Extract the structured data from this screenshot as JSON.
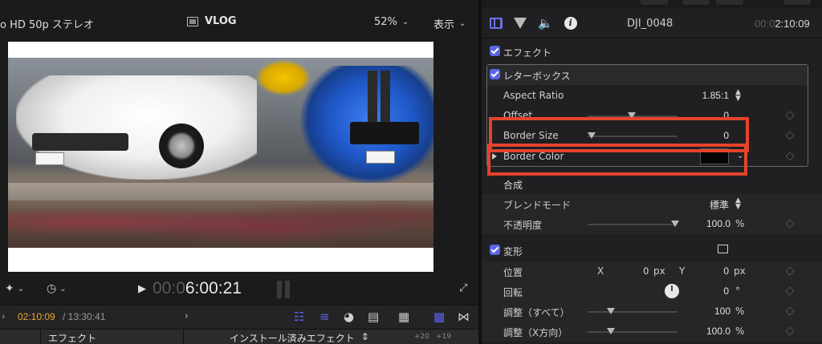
{
  "viewer": {
    "format_label": "o HD 50p ステレオ",
    "library_name": "VLOG",
    "zoom": "52%",
    "view_menu": "表示",
    "timecode_dim": "00:0",
    "timecode_bright": "6:00:21"
  },
  "timeline_bar": {
    "current_time": "02:10:09",
    "total_time": "/ 13:30:41"
  },
  "effects_browser": {
    "label": "エフェクト",
    "selector": "インストール済みエフェクト",
    "thumb_labels": [
      "+20",
      "+19"
    ]
  },
  "inspector": {
    "clip_name": "DJI_0048",
    "duration_dim": "00:0",
    "duration_bright": "2:10:09",
    "effects_header": "エフェクト",
    "letterbox": {
      "title": "レターボックス",
      "aspect_ratio_label": "Aspect Ratio",
      "aspect_ratio_value": "1.85:1",
      "offset_label": "Offset",
      "offset_value": "0",
      "border_size_label": "Border Size",
      "border_size_value": "0",
      "border_color_label": "Border Color",
      "border_color": "#050505"
    },
    "composite": {
      "title": "合成",
      "blend_mode_label": "ブレンドモード",
      "blend_mode_value": "標準",
      "opacity_label": "不透明度",
      "opacity_value": "100.0",
      "opacity_unit": "%"
    },
    "transform": {
      "title": "変形",
      "position_label": "位置",
      "x_label": "X",
      "x_value": "0",
      "y_label": "Y",
      "y_value": "0",
      "px_unit": "px",
      "rotation_label": "回転",
      "rotation_value": "0",
      "rotation_unit": "°",
      "scale_all_label": "調整（すべて）",
      "scale_all_value": "100",
      "scale_x_label": "調整（X方向）",
      "scale_x_value": "100.0",
      "percent_unit": "%"
    }
  },
  "colors": {
    "accent": "#5b63e6",
    "highlight": "#e5432d",
    "timecode_orange": "#e9a92a"
  }
}
